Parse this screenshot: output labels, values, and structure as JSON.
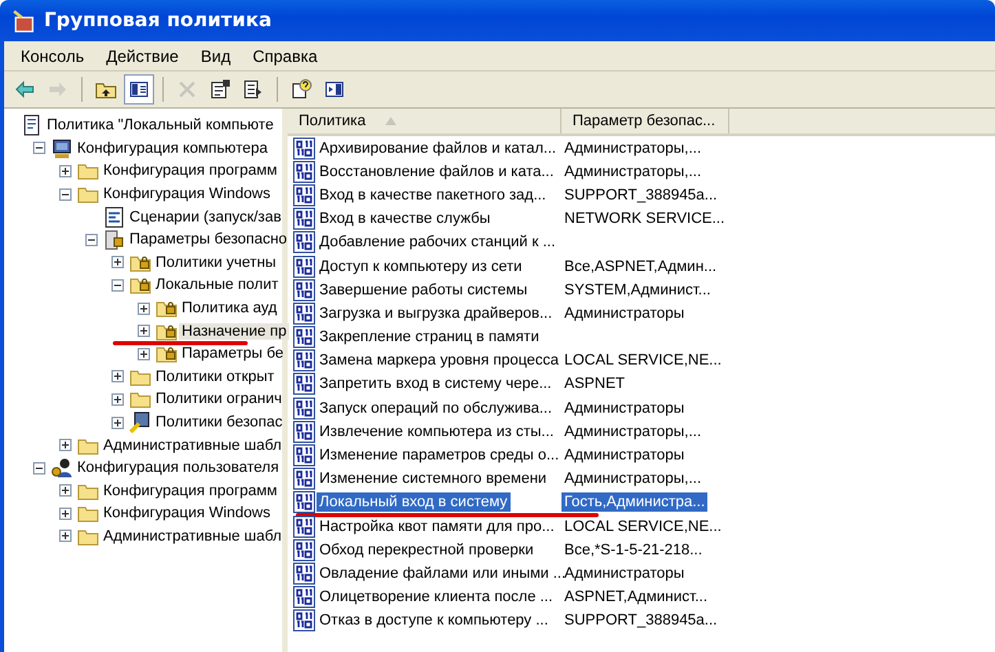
{
  "window": {
    "title": "Групповая политика"
  },
  "menu": [
    "Консоль",
    "Действие",
    "Вид",
    "Справка"
  ],
  "toolbar": [
    {
      "kind": "back",
      "disabled": false,
      "pressed": false
    },
    {
      "kind": "forward",
      "disabled": true,
      "pressed": false
    },
    {
      "kind": "sep"
    },
    {
      "kind": "up",
      "disabled": false,
      "pressed": false
    },
    {
      "kind": "tree",
      "disabled": false,
      "pressed": true
    },
    {
      "kind": "sep"
    },
    {
      "kind": "delete",
      "disabled": true,
      "pressed": false
    },
    {
      "kind": "properties",
      "disabled": false,
      "pressed": false
    },
    {
      "kind": "export",
      "disabled": false,
      "pressed": false
    },
    {
      "kind": "sep"
    },
    {
      "kind": "help",
      "disabled": false,
      "pressed": false
    },
    {
      "kind": "pane",
      "disabled": false,
      "pressed": false
    }
  ],
  "tree": [
    {
      "label": "Политика \"Локальный компьюте",
      "kind": "policy",
      "selected": false,
      "children": [
        {
          "label": "Конфигурация компьютера",
          "kind": "computer",
          "expanded": true,
          "selected": false,
          "children": [
            {
              "label": "Конфигурация программ",
              "kind": "folder",
              "expanded": false,
              "selected": false
            },
            {
              "label": "Конфигурация Windows",
              "kind": "folder",
              "expanded": true,
              "selected": false,
              "children": [
                {
                  "label": "Сценарии (запуск/зав",
                  "kind": "script",
                  "selected": false
                },
                {
                  "label": "Параметры безопасно",
                  "kind": "secure",
                  "expanded": true,
                  "selected": false,
                  "children": [
                    {
                      "label": "Политики учетны",
                      "kind": "lockfolder",
                      "expanded": false,
                      "selected": false
                    },
                    {
                      "label": "Локальные полит",
                      "kind": "lockfolder",
                      "expanded": true,
                      "selected": false,
                      "children": [
                        {
                          "label": "Политика ауд",
                          "kind": "lockfolder",
                          "expanded": false,
                          "selected": false
                        },
                        {
                          "label": "Назначение пр",
                          "kind": "lockfolder",
                          "expanded": false,
                          "selected": true,
                          "marked": true
                        },
                        {
                          "label": "Параметры бе",
                          "kind": "lockfolder",
                          "expanded": false,
                          "selected": false
                        }
                      ]
                    },
                    {
                      "label": "Политики открыт",
                      "kind": "folder",
                      "expanded": false,
                      "selected": false
                    },
                    {
                      "label": "Политики огранич",
                      "kind": "folder",
                      "expanded": false,
                      "selected": false
                    },
                    {
                      "label": "Политики безопас",
                      "kind": "ipsec",
                      "expanded": false,
                      "selected": false
                    }
                  ]
                }
              ]
            },
            {
              "label": "Административные шабл",
              "kind": "folder",
              "expanded": false,
              "selected": false
            }
          ]
        },
        {
          "label": "Конфигурация пользователя",
          "kind": "user",
          "expanded": true,
          "selected": false,
          "children": [
            {
              "label": "Конфигурация программ",
              "kind": "folder",
              "expanded": false,
              "selected": false
            },
            {
              "label": "Конфигурация Windows",
              "kind": "folder",
              "expanded": false,
              "selected": false
            },
            {
              "label": "Административные шабл",
              "kind": "folder",
              "expanded": false,
              "selected": false
            }
          ]
        }
      ]
    }
  ],
  "table": {
    "columns": [
      {
        "label": "Политика",
        "sorted": true
      },
      {
        "label": "Параметр безопас...",
        "sorted": false
      }
    ],
    "rows": [
      {
        "name": "Архивирование файлов и катал...",
        "value": "Администраторы,...",
        "selected": false
      },
      {
        "name": "Восстановление файлов и ката...",
        "value": "Администраторы,...",
        "selected": false
      },
      {
        "name": "Вход в качестве пакетного зад...",
        "value": "SUPPORT_388945a...",
        "selected": false
      },
      {
        "name": "Вход в качестве службы",
        "value": "NETWORK SERVICE...",
        "selected": false
      },
      {
        "name": "Добавление рабочих станций к ...",
        "selected": false
      },
      {
        "name": "Доступ к компьютеру из сети",
        "value": "Все,ASPNET,Админ...",
        "selected": false
      },
      {
        "name": "Завершение работы системы",
        "value": "SYSTEM,Админист...",
        "selected": false
      },
      {
        "name": "Загрузка и выгрузка драйверов...",
        "value": "Администраторы",
        "selected": false
      },
      {
        "name": "Закрепление страниц в памяти",
        "selected": false
      },
      {
        "name": "Замена маркера уровня процесса",
        "value": "LOCAL SERVICE,NE...",
        "selected": false
      },
      {
        "name": "Запретить вход в систему чере...",
        "value": "ASPNET",
        "selected": false
      },
      {
        "name": "Запуск операций по обслужива...",
        "value": "Администраторы",
        "selected": false
      },
      {
        "name": "Извлечение компьютера из сты...",
        "value": "Администраторы,...",
        "selected": false
      },
      {
        "name": "Изменение параметров среды о...",
        "value": "Администраторы",
        "selected": false
      },
      {
        "name": "Изменение системного времени",
        "value": "Администраторы,...",
        "selected": false
      },
      {
        "name": "Локальный вход в систему",
        "value": "Гость,Администра...",
        "selected": true,
        "marked": true
      },
      {
        "name": "Настройка квот памяти для про...",
        "value": "LOCAL SERVICE,NE...",
        "selected": false
      },
      {
        "name": "Обход перекрестной проверки",
        "value": "Все,*S-1-5-21-218...",
        "selected": false
      },
      {
        "name": "Овладение файлами или иными ...",
        "value": "Администраторы",
        "selected": false
      },
      {
        "name": "Олицетворение клиента после ...",
        "value": "ASPNET,Админист...",
        "selected": false
      },
      {
        "name": "Отказ в доступе к компьютеру ...",
        "value": "SUPPORT_388945a...",
        "selected": false
      }
    ]
  }
}
